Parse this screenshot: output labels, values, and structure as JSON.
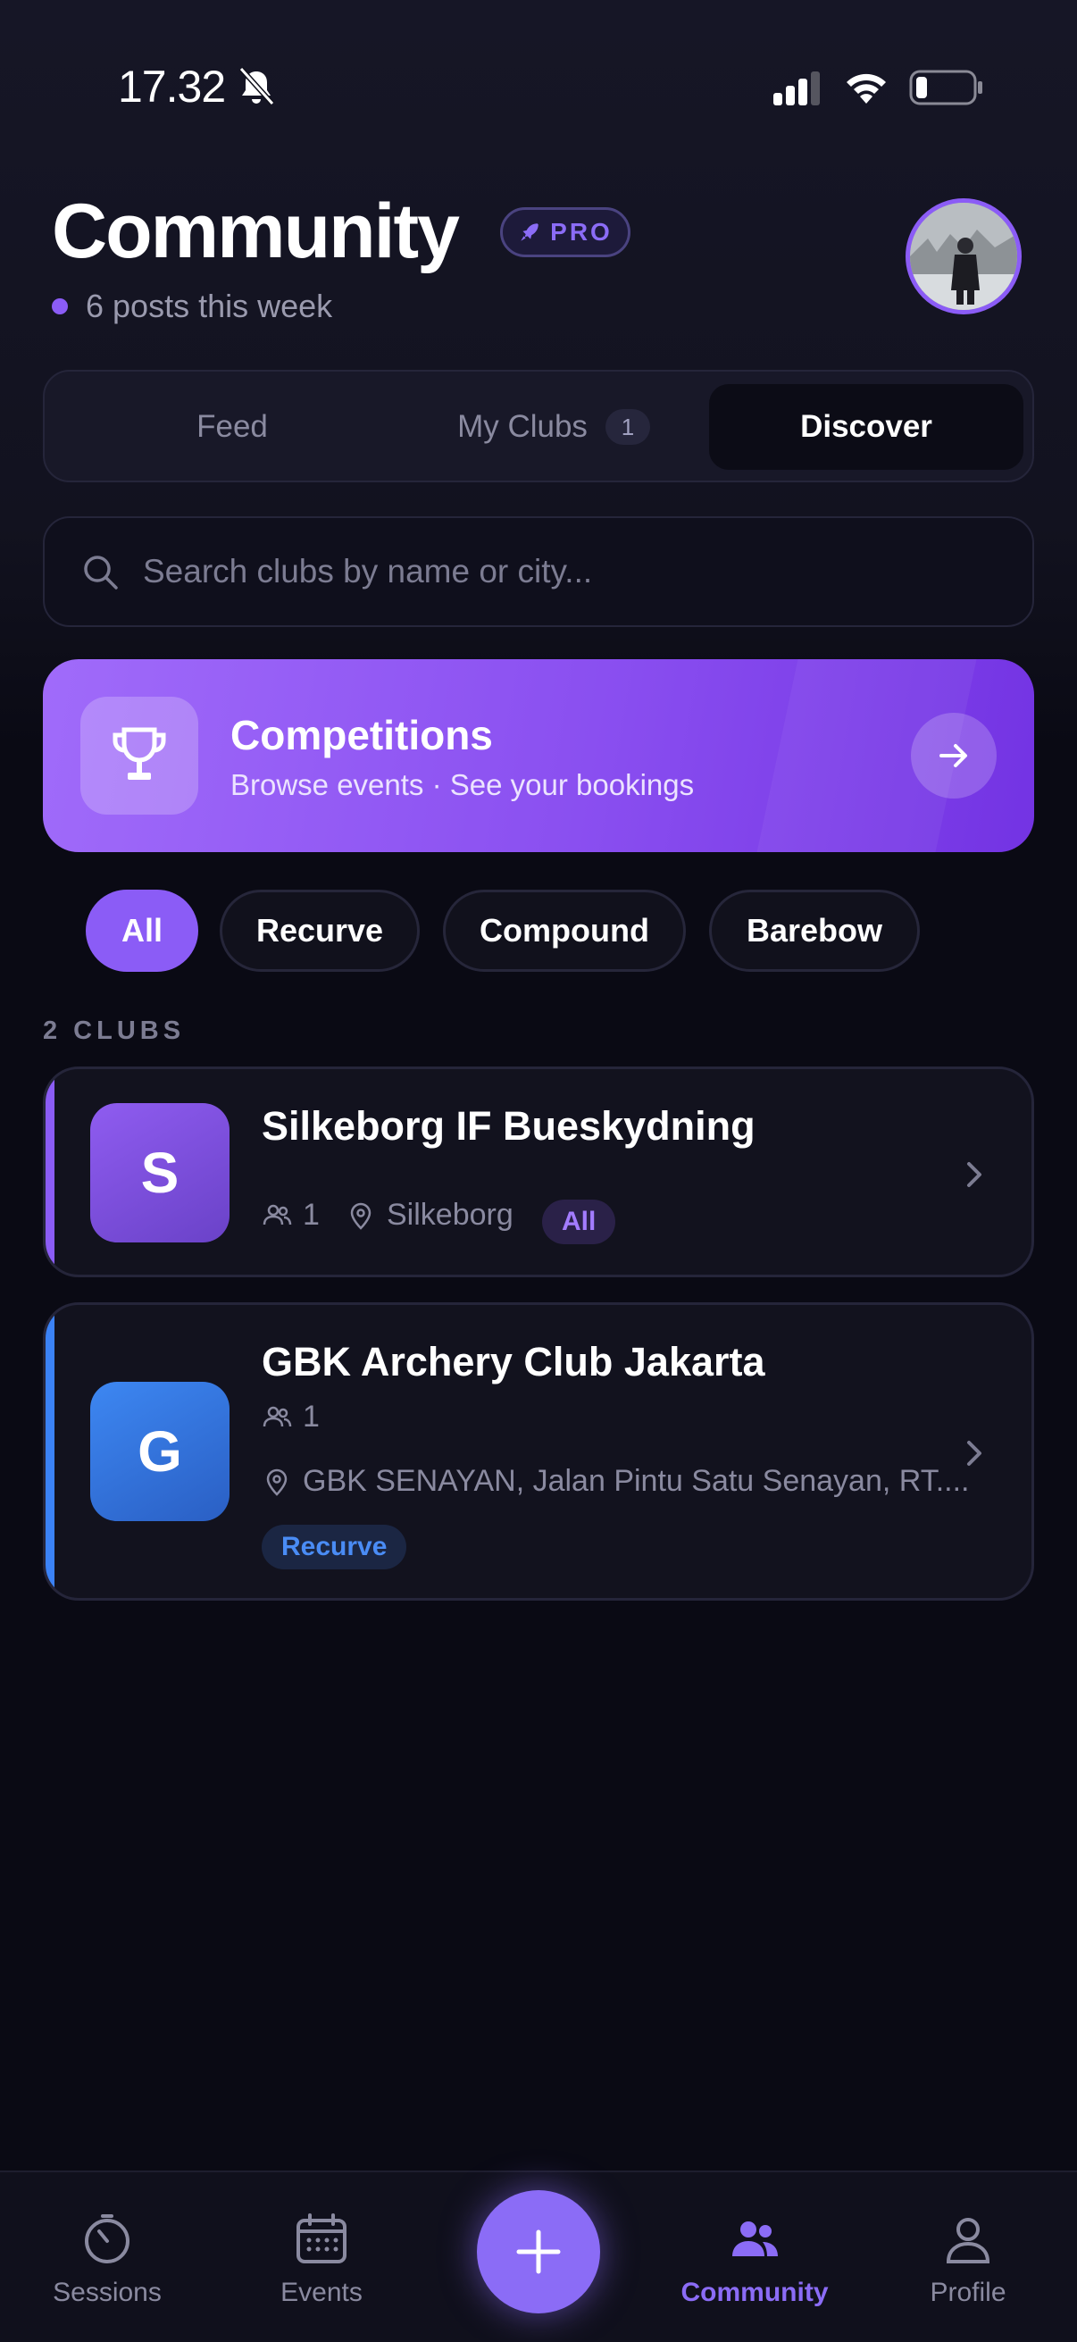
{
  "status_bar": {
    "time": "17.32"
  },
  "header": {
    "title": "Community",
    "badge": "PRO",
    "subtitle": "6 posts this week"
  },
  "tabs": [
    {
      "label": "Feed"
    },
    {
      "label": "My Clubs",
      "count": "1"
    },
    {
      "label": "Discover",
      "active": true
    }
  ],
  "search": {
    "placeholder": "Search clubs by name or city..."
  },
  "competitions": {
    "title": "Competitions",
    "subtitle": "Browse events · See your bookings"
  },
  "filters": [
    {
      "label": "All",
      "active": true
    },
    {
      "label": "Recurve"
    },
    {
      "label": "Compound"
    },
    {
      "label": "Barebow"
    }
  ],
  "section_label": "2 CLUBS",
  "clubs": [
    {
      "initial": "S",
      "name": "Silkeborg IF Bueskydning",
      "members": "1",
      "location": "Silkeborg",
      "tag": "All",
      "accent": "#8b5cf6"
    },
    {
      "initial": "G",
      "name": "GBK Archery Club Jakarta",
      "members": "1",
      "location": "GBK SENAYAN, Jalan Pintu Satu Senayan, RT....",
      "tag": "Recurve",
      "accent": "#3b82f6"
    }
  ],
  "bottom_nav": [
    {
      "label": "Sessions",
      "icon": "stopwatch-icon"
    },
    {
      "label": "Events",
      "icon": "calendar-icon"
    },
    {
      "label": "",
      "icon": "plus-icon"
    },
    {
      "label": "Community",
      "icon": "people-icon",
      "active": true
    },
    {
      "label": "Profile",
      "icon": "person-icon"
    }
  ],
  "colors": {
    "accent": "#8b5cf6",
    "background": "#0a0a14",
    "blue": "#3b82f6"
  }
}
